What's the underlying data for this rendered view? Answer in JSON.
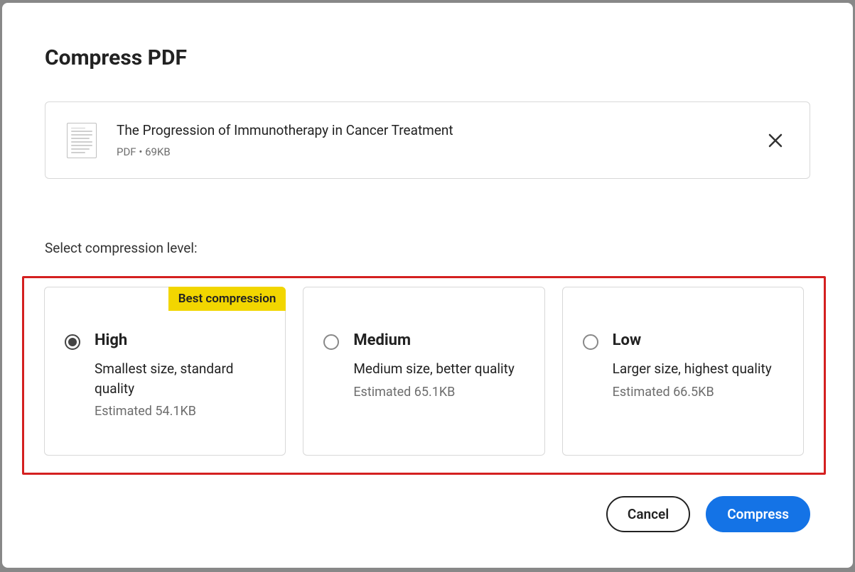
{
  "dialog": {
    "title": "Compress PDF",
    "section_label": "Select compression level:",
    "cancel_label": "Cancel",
    "confirm_label": "Compress"
  },
  "file": {
    "name": "The Progression of Immunotherapy in Cancer Treatment",
    "meta": "PDF • 69KB"
  },
  "badge_label": "Best compression",
  "options": [
    {
      "title": "High",
      "desc": "Smallest size, standard quality",
      "estimated": "Estimated 54.1KB",
      "selected": true,
      "badge": true
    },
    {
      "title": "Medium",
      "desc": "Medium size, better quality",
      "estimated": "Estimated 65.1KB",
      "selected": false,
      "badge": false
    },
    {
      "title": "Low",
      "desc": "Larger size, highest quality",
      "estimated": "Estimated 66.5KB",
      "selected": false,
      "badge": false
    }
  ]
}
